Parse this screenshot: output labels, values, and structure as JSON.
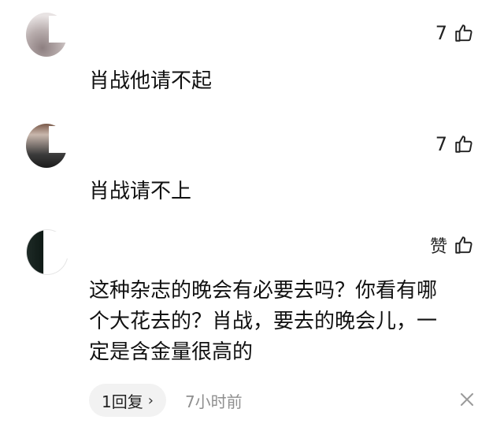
{
  "comments": [
    {
      "likes": "7",
      "text": "肖战他请不起"
    },
    {
      "likes": "7",
      "text": "肖战请不上"
    },
    {
      "likes": "赞",
      "text_lines": [
        "这种杂志的晚会有必要去吗？你看有哪",
        "个大花去的？肖战，要去的晚会儿，一",
        "定是含金量很高的"
      ],
      "reply_label": "1回复",
      "time": "7小时前"
    }
  ]
}
